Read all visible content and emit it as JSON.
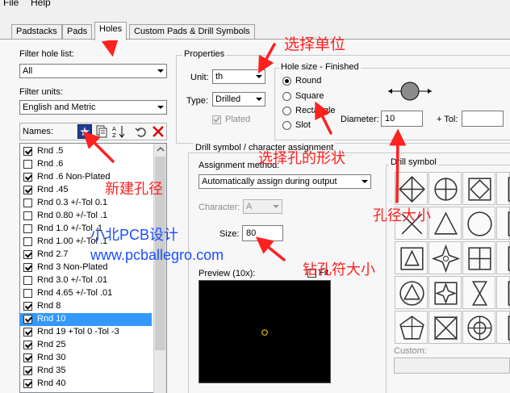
{
  "menu": {
    "file": "File",
    "help": "Help"
  },
  "tabs": [
    {
      "label": "Padstacks"
    },
    {
      "label": "Pads"
    },
    {
      "label": "Holes"
    },
    {
      "label": "Custom Pads & Drill Symbols"
    }
  ],
  "filter": {
    "hole_list_label": "Filter hole list:",
    "hole_list_value": "All",
    "units_label": "Filter units:",
    "units_value": "English and Metric"
  },
  "names_label": "Names:",
  "holes": [
    {
      "label": "Rnd .5",
      "checked": true
    },
    {
      "label": "Rnd .6",
      "checked": false
    },
    {
      "label": "Rnd .6 Non-Plated",
      "checked": true
    },
    {
      "label": "Rnd .45",
      "checked": true
    },
    {
      "label": "Rnd 0.3 +/-Tol 0.1",
      "checked": false
    },
    {
      "label": "Rnd 0.80 +/-Tol .1",
      "checked": false
    },
    {
      "label": "Rnd 1.0 +/-Tol .1",
      "checked": false
    },
    {
      "label": "Rnd 1.00 +/-Tol .1",
      "checked": false
    },
    {
      "label": "Rnd 2.7",
      "checked": true
    },
    {
      "label": "Rnd 3 Non-Plated",
      "checked": true
    },
    {
      "label": "Rnd 3.0 +/-Tol .01",
      "checked": false
    },
    {
      "label": "Rnd 4.65 +/-Tol .01",
      "checked": false
    },
    {
      "label": "Rnd 8",
      "checked": true
    },
    {
      "label": "Rnd 10",
      "checked": true,
      "selected": true
    },
    {
      "label": "Rnd 19 +Tol 0 -Tol -3",
      "checked": true
    },
    {
      "label": "Rnd 25",
      "checked": true
    },
    {
      "label": "Rnd 30",
      "checked": true
    },
    {
      "label": "Rnd 35",
      "checked": true
    },
    {
      "label": "Rnd 40",
      "checked": true
    }
  ],
  "properties": {
    "title": "Properties",
    "unit_label": "Unit:",
    "unit_value": "th",
    "type_label": "Type:",
    "type_value": "Drilled",
    "plated_label": "Plated"
  },
  "hole_size": {
    "title": "Hole size - Finished",
    "shapes": [
      "Round",
      "Square",
      "Rectangle",
      "Slot"
    ],
    "selected_shape": "Round",
    "diameter_label": "Diameter:",
    "diameter_value": "10",
    "tol_label": "+ Tol:",
    "tol_value": ""
  },
  "drill": {
    "title": "Drill symbol / character assignment",
    "assignment_label": "Assignment method:",
    "assignment_value": "Automatically assign during output",
    "character_label": "Character:",
    "character_value": "A",
    "size_label": "Size:",
    "size_value": "80",
    "preview_label": "Preview (10x):",
    "fit_label": "Fit",
    "symbol_title": "Drill symbol",
    "custom_label": "Custom:"
  },
  "annotations": {
    "select_unit": "选择单位",
    "new_hole": "新建孔径",
    "select_shape": "选择孔的形状",
    "hole_size": "孔径大小",
    "drill_size": "钻孔符大小",
    "watermark_name": "小北PCB设计",
    "watermark_url": "www.pcballegro.com"
  },
  "colors": {
    "accent_red": "#ff2020",
    "selection": "#3399ff",
    "watermark_blue": "#1a4fff"
  }
}
